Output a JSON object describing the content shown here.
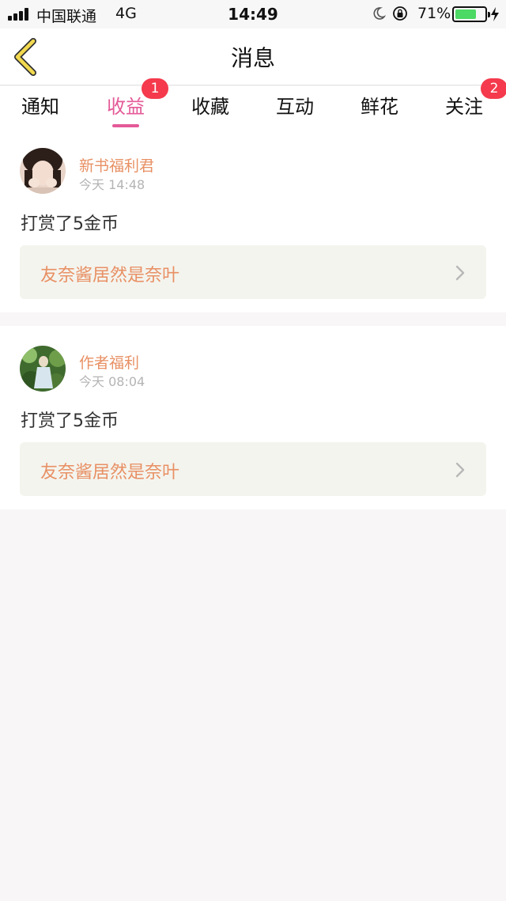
{
  "status_bar": {
    "carrier": "中国联通",
    "network": "4G",
    "time": "14:49",
    "battery": "71%",
    "battery_level": 0.71
  },
  "nav": {
    "title": "消息",
    "back_icon": "chevron-left-icon"
  },
  "tabs": [
    {
      "label": "通知",
      "active": false,
      "badge": null
    },
    {
      "label": "收益",
      "active": true,
      "badge": "1"
    },
    {
      "label": "收藏",
      "active": false,
      "badge": null
    },
    {
      "label": "互动",
      "active": false,
      "badge": null
    },
    {
      "label": "鲜花",
      "active": false,
      "badge": null
    },
    {
      "label": "关注",
      "active": false,
      "badge": "2"
    }
  ],
  "messages": [
    {
      "username": "新书福利君",
      "time": "今天 14:48",
      "content": "打赏了5金币",
      "book_title": "友奈酱居然是奈叶"
    },
    {
      "username": "作者福利",
      "time": "今天 08:04",
      "content": "打赏了5金币",
      "book_title": "友奈酱居然是奈叶"
    }
  ],
  "colors": {
    "accent": "#e45a98",
    "name": "#e89064",
    "badge": "#f43a4c",
    "back_arrow": "#f2d94e"
  }
}
